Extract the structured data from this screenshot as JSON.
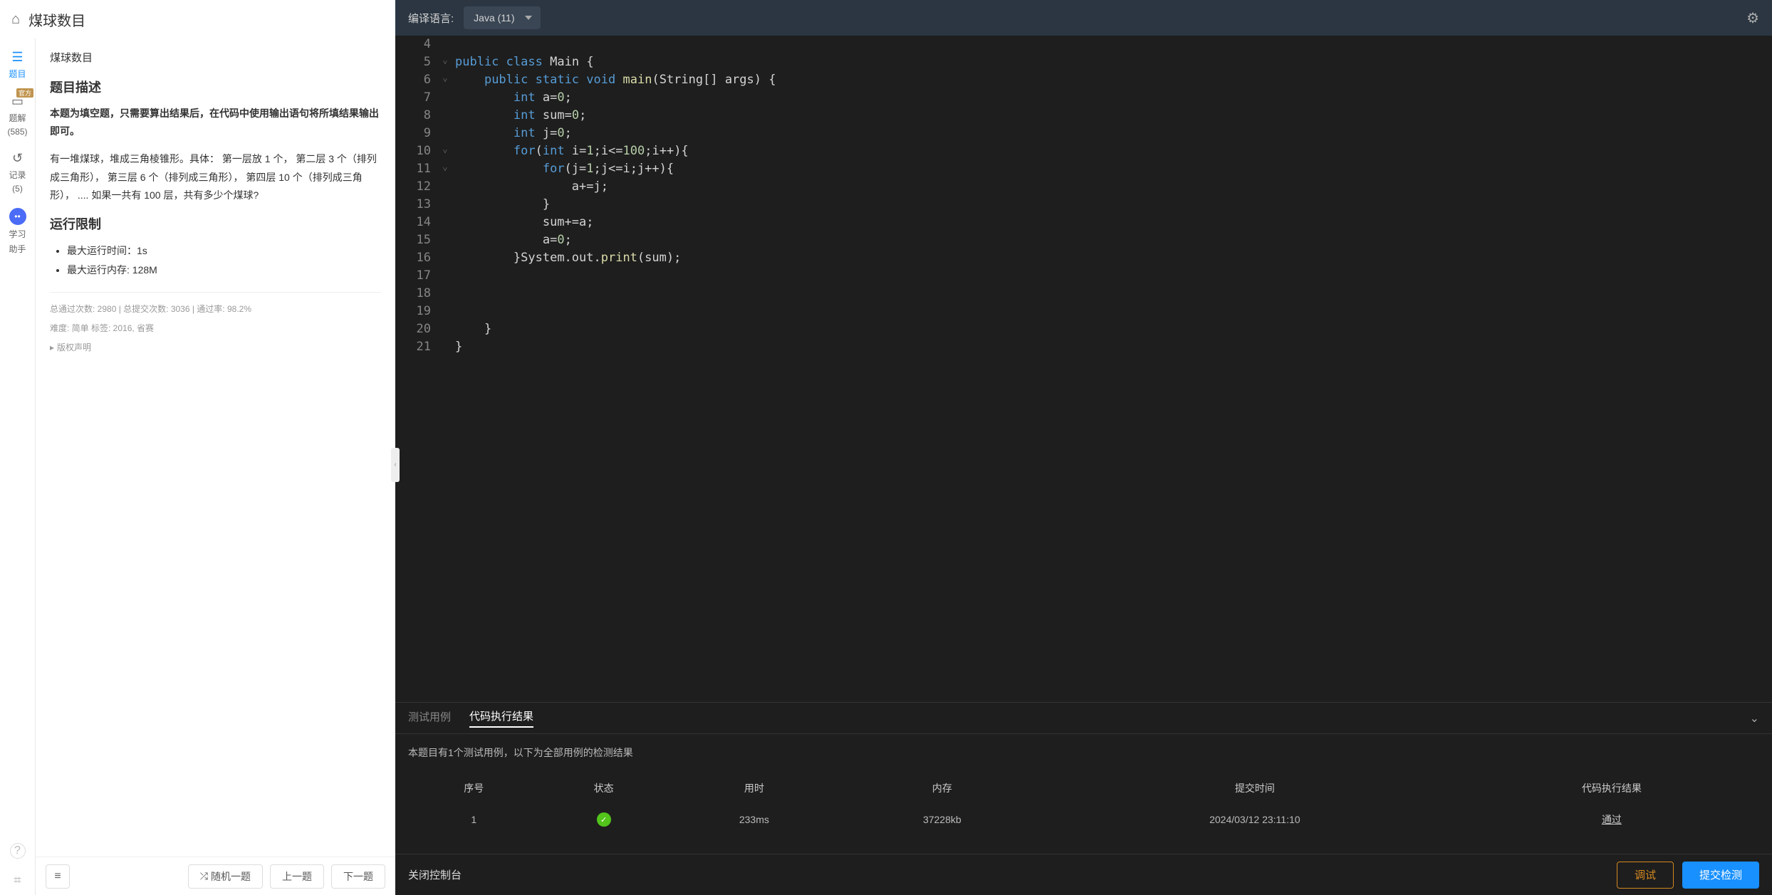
{
  "header": {
    "title": "煤球数目"
  },
  "sidebar": {
    "items": [
      {
        "icon": "list",
        "label": "题目",
        "active": true
      },
      {
        "icon": "book",
        "label": "题解",
        "sub": "(585)",
        "badge": "官方"
      },
      {
        "icon": "history",
        "label": "记录",
        "sub": "(5)"
      },
      {
        "icon": "bot",
        "label": "学习",
        "sub": "助手"
      }
    ],
    "help_icon": "?",
    "stairs_icon": "⇲"
  },
  "problem": {
    "name": "煤球数目",
    "section_desc_title": "题目描述",
    "bold_note": "本题为填空题，只需要算出结果后，在代码中使用输出语句将所填结果输出即可。",
    "desc": "有一堆煤球，堆成三角棱锥形。具体： 第一层放 1 个， 第二层 3 个（排列成三角形）， 第三层 6 个（排列成三角形）， 第四层 10 个（排列成三角形）， .... 如果一共有 100 层，共有多少个煤球?",
    "section_limit_title": "运行限制",
    "limits": [
      "最大运行时间：1s",
      "最大运行内存: 128M"
    ],
    "stats": "总通过次数: 2980  |  总提交次数: 3036  |  通过率: 98.2%",
    "meta": "难度: 简单   标签: 2016, 省赛",
    "copyright": "版权声明"
  },
  "left_footer": {
    "list_icon": "≡",
    "random": "随机一题",
    "prev": "上一题",
    "next": "下一题"
  },
  "editor": {
    "lang_label": "编译语言:",
    "lang_value": "Java (11)",
    "gear": "⚙",
    "code_lines": [
      {
        "n": 4,
        "fold": "",
        "html": ""
      },
      {
        "n": 5,
        "fold": "˅",
        "html": "<span class='kw'>public</span> <span class='kw'>class</span> <span class='id'>Main</span> <span class='pu'>{</span>"
      },
      {
        "n": 6,
        "fold": "˅",
        "html": "    <span class='kw'>public</span> <span class='kw'>static</span> <span class='ty'>void</span> <span class='fn'>main</span><span class='pu'>(</span><span class='id'>String[] args</span><span class='pu'>) {</span>"
      },
      {
        "n": 7,
        "fold": "",
        "html": "        <span class='ty'>int</span> <span class='id'>a</span><span class='pu'>=</span><span class='nu'>0</span><span class='pu'>;</span>"
      },
      {
        "n": 8,
        "fold": "",
        "html": "        <span class='ty'>int</span> <span class='id'>sum</span><span class='pu'>=</span><span class='nu'>0</span><span class='pu'>;</span>"
      },
      {
        "n": 9,
        "fold": "",
        "html": "        <span class='ty'>int</span> <span class='id'>j</span><span class='pu'>=</span><span class='nu'>0</span><span class='pu'>;</span>"
      },
      {
        "n": 10,
        "fold": "˅",
        "html": "        <span class='kw'>for</span><span class='pu'>(</span><span class='ty'>int</span> <span class='id'>i</span><span class='pu'>=</span><span class='nu'>1</span><span class='pu'>;i&lt;=</span><span class='nu'>100</span><span class='pu'>;i++){</span>"
      },
      {
        "n": 11,
        "fold": "˅",
        "html": "            <span class='kw'>for</span><span class='pu'>(j=</span><span class='nu'>1</span><span class='pu'>;j&lt;=i;j++){</span>"
      },
      {
        "n": 12,
        "fold": "",
        "html": "                <span class='id'>a</span><span class='pu'>+=j;</span>"
      },
      {
        "n": 13,
        "fold": "",
        "html": "            <span class='pu'>}</span>"
      },
      {
        "n": 14,
        "fold": "",
        "html": "            <span class='id'>sum</span><span class='pu'>+=a;</span>"
      },
      {
        "n": 15,
        "fold": "",
        "html": "            <span class='id'>a</span><span class='pu'>=</span><span class='nu'>0</span><span class='pu'>;</span>"
      },
      {
        "n": 16,
        "fold": "",
        "html": "        <span class='pu'>}</span><span class='id'>System.out.</span><span class='fn'>print</span><span class='pu'>(sum);</span>"
      },
      {
        "n": 17,
        "fold": "",
        "html": ""
      },
      {
        "n": 18,
        "fold": "",
        "html": ""
      },
      {
        "n": 19,
        "fold": "",
        "html": ""
      },
      {
        "n": 20,
        "fold": "",
        "html": "    <span class='pu'>}</span>"
      },
      {
        "n": 21,
        "fold": "",
        "html": "<span class='pu'>}</span>"
      }
    ]
  },
  "results": {
    "tab_testcase": "测试用例",
    "tab_result": "代码执行结果",
    "note": "本题目有1个测试用例，以下为全部用例的检测结果",
    "headers": {
      "idx": "序号",
      "status": "状态",
      "time": "用时",
      "mem": "内存",
      "submit": "提交时间",
      "result": "代码执行结果"
    },
    "rows": [
      {
        "idx": "1",
        "status": "ok",
        "time": "233ms",
        "mem": "37228kb",
        "submit": "2024/03/12 23:11:10",
        "result": "通过"
      }
    ]
  },
  "right_footer": {
    "close": "关闭控制台",
    "debug": "调试",
    "submit": "提交检测"
  }
}
